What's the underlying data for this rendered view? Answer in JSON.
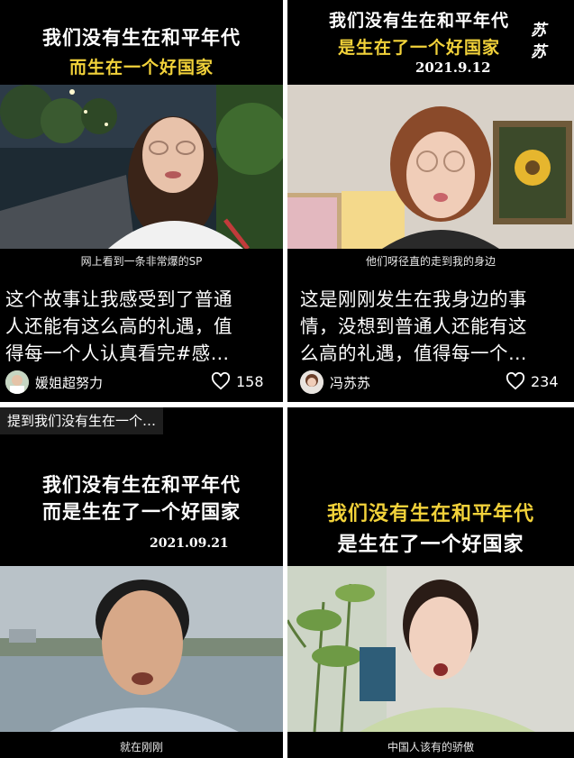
{
  "cards": [
    {
      "headline1": "我们没有生在和平年代",
      "headline2": "而生在一个好国家",
      "caption": "网上看到一条非常爆的SP",
      "desc_lines": [
        "这个故事让我感受到了普通",
        "人还能有这么高的礼遇，值",
        "得每一个人认真看完#感…"
      ],
      "author": "媛姐超努力",
      "likes": "158"
    },
    {
      "headline1": "我们没有生在和平年代",
      "headline2": "是生在了一个好国家",
      "date": "2021.9.12",
      "signature": "苏苏",
      "caption": "他们呀径直的走到我的身边",
      "desc_lines": [
        "这是刚刚发生在我身边的事",
        "情，没想到普通人还能有这",
        "么高的礼遇，值得每一个…"
      ],
      "author": "冯苏苏",
      "likes": "234"
    },
    {
      "tag": "提到我们没有生在一个…",
      "headline1": "我们没有生在和平年代",
      "headline2": "而是生在了一个好国家",
      "date": "2021.09.21",
      "caption": "就在刚刚"
    },
    {
      "headline1": "我们没有生在和平年代",
      "headline2": "是生在了一个好国家",
      "caption": "中国人该有的骄傲"
    }
  ],
  "icons": {
    "like": "heart-outline-icon"
  },
  "colors": {
    "accent_yellow": "#f2d23a",
    "card_bg": "#000000"
  }
}
